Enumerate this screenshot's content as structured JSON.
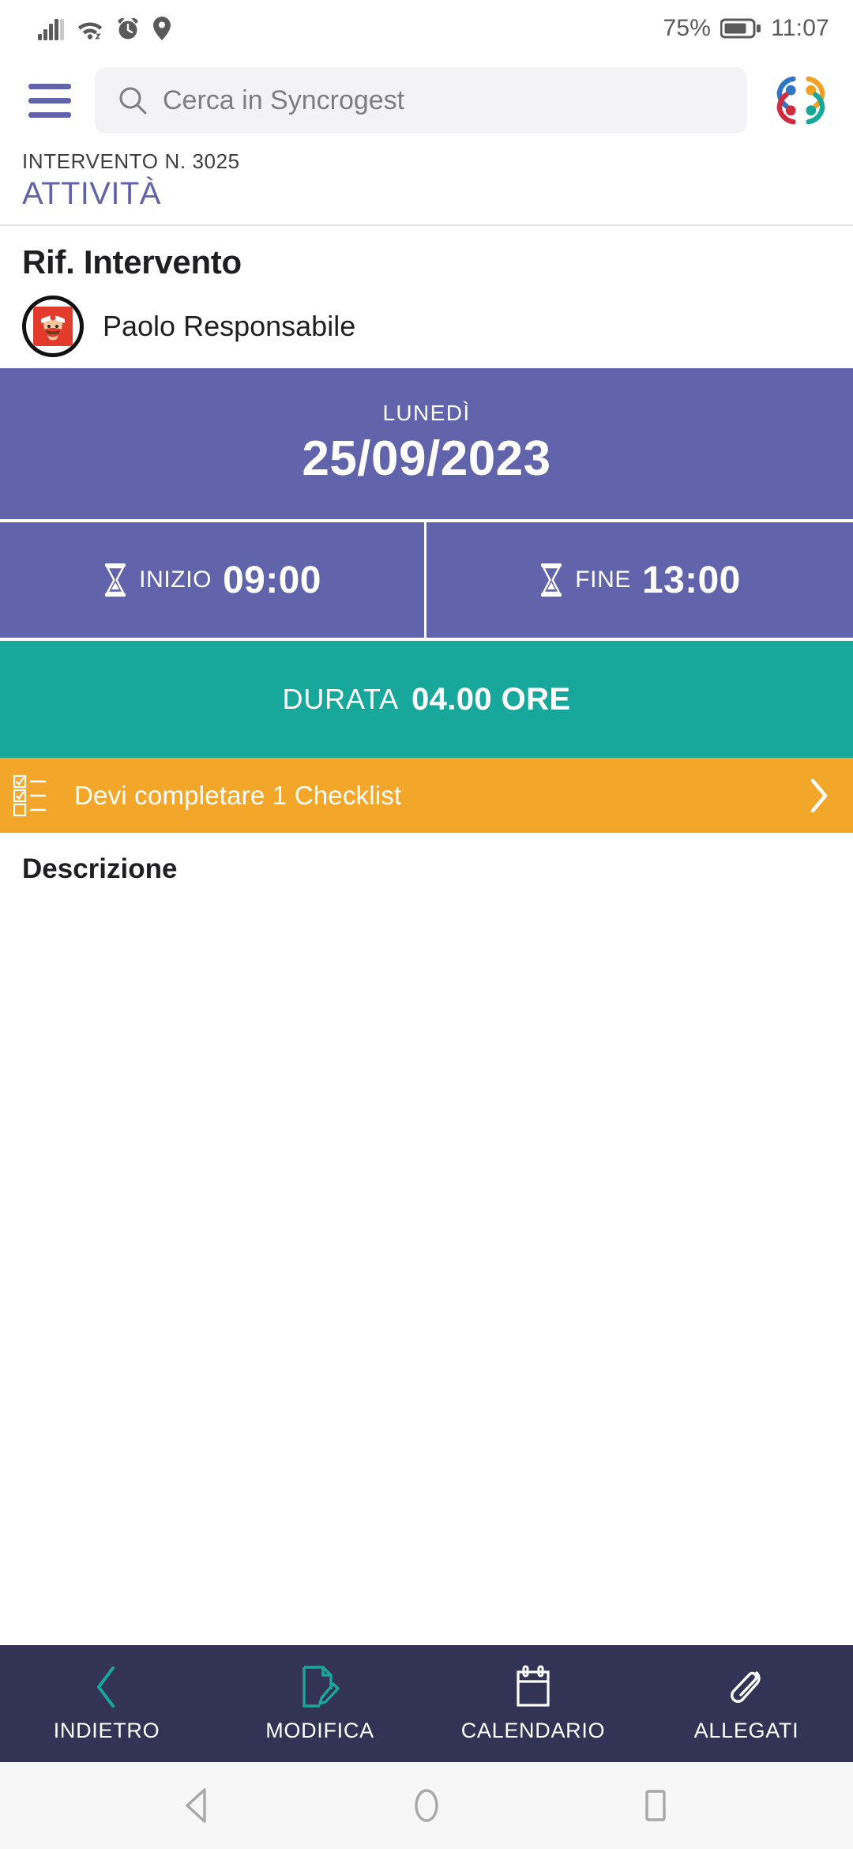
{
  "status_bar": {
    "icons_left": [
      "signal-icon",
      "wifi-icon",
      "alarm-icon",
      "location-icon"
    ],
    "battery_percent": "75%",
    "battery_icon": "battery-icon",
    "time": "11:07"
  },
  "header": {
    "menu_icon": "hamburger-menu-icon",
    "search": {
      "icon": "search-icon",
      "placeholder": "Cerca in Syncrogest",
      "value": ""
    },
    "logo": "syncrogest-logo"
  },
  "title": {
    "kicker": "INTERVENTO N. 3025",
    "main": "ATTIVITÀ"
  },
  "reference": {
    "heading": "Rif. Intervento",
    "avatar": "user-avatar",
    "person_name": "Paolo Responsabile"
  },
  "schedule": {
    "weekday": "LUNEDÌ",
    "date": "25/09/2023",
    "start": {
      "icon": "hourglass-icon",
      "label": "INIZIO",
      "value": "09:00"
    },
    "end": {
      "icon": "hourglass-icon",
      "label": "FINE",
      "value": "13:00"
    },
    "duration": {
      "label": "DURATA",
      "value": "04.00 ORE"
    }
  },
  "checklist_banner": {
    "icon": "checklist-icon",
    "text": "Devi completare 1 Checklist",
    "chevron": "chevron-right-icon"
  },
  "description": {
    "title": "Descrizione",
    "body": ""
  },
  "bottom_nav": {
    "items": [
      {
        "label": "INDIETRO",
        "icon": "chevron-left-icon"
      },
      {
        "label": "MODIFICA",
        "icon": "document-edit-icon"
      },
      {
        "label": "CALENDARIO",
        "icon": "calendar-icon"
      },
      {
        "label": "ALLEGATI",
        "icon": "paperclip-icon"
      }
    ]
  },
  "system_nav": {
    "back": "android-back-icon",
    "home": "android-home-icon",
    "recents": "android-recents-icon"
  },
  "colors": {
    "purple": "#6264ab",
    "teal": "#17a79b",
    "orange": "#f3a72a",
    "navy": "#333355",
    "nav_icon_active": "#17a79b"
  }
}
